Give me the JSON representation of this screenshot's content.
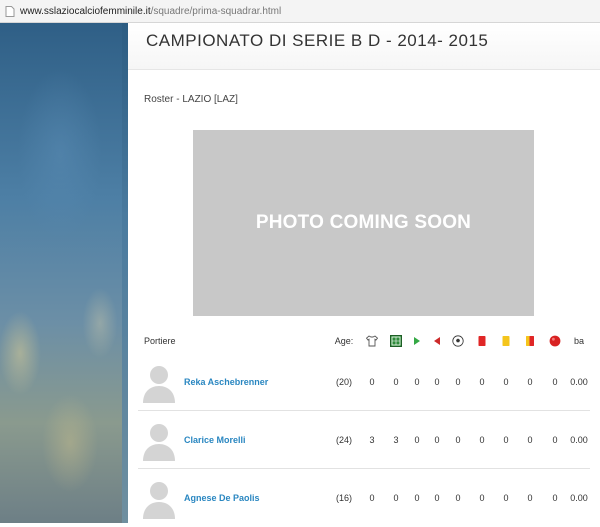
{
  "browser": {
    "url_host": "www.sslaziocalciofemminile.it",
    "url_path": "/squadre/prima-squadrar.html"
  },
  "page": {
    "title": "CAMPIONATO DI SERIE B D - 2014- 2015",
    "roster": "Roster - LAZIO [LAZ]",
    "photo_placeholder": "PHOTO COMING SOON"
  },
  "table": {
    "position_label": "Portiere",
    "age_label": "Age:",
    "last_col_label": "ba",
    "stat_icons": [
      "shirt-icon",
      "substitution-icon",
      "sub-in-arrow-icon",
      "sub-out-arrow-icon",
      "goal-ball-icon",
      "red-card-icon",
      "yellow-card-icon",
      "second-yellow-card-icon",
      "own-goal-icon"
    ],
    "colors": {
      "name": "#2a87c1",
      "red_card": "#e02626",
      "yellow_card": "#f4c51c"
    },
    "players": [
      {
        "name": "Reka Aschebrenner",
        "age": "(20)",
        "stats": [
          "0",
          "0",
          "0",
          "0",
          "0",
          "0",
          "0",
          "0",
          "0"
        ],
        "ba": "0.00"
      },
      {
        "name": "Clarice Morelli",
        "age": "(24)",
        "stats": [
          "3",
          "3",
          "0",
          "0",
          "0",
          "0",
          "0",
          "0",
          "0"
        ],
        "ba": "0.00"
      },
      {
        "name": "Agnese De Paolis",
        "age": "(16)",
        "stats": [
          "0",
          "0",
          "0",
          "0",
          "0",
          "0",
          "0",
          "0",
          "0"
        ],
        "ba": "0.00"
      }
    ]
  }
}
